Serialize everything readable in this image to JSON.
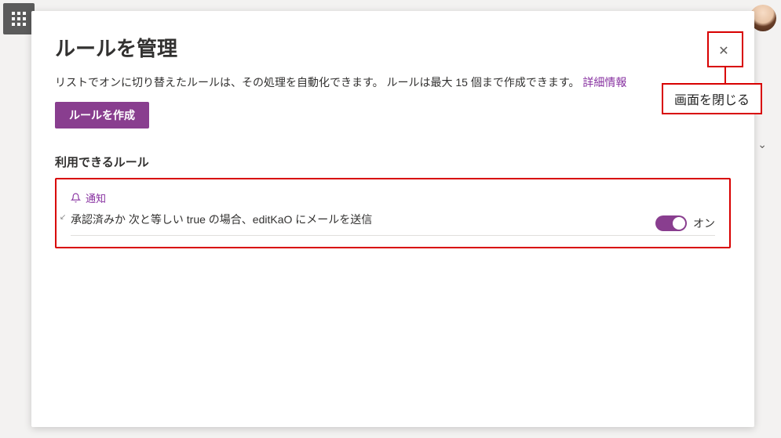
{
  "header": {
    "waffle_name": "app-launcher-icon"
  },
  "panel": {
    "title": "ルールを管理",
    "description": "リストでオンに切り替えたルールは、その処理を自動化できます。 ルールは最大 15 個まで作成できます。",
    "detail_link": "詳細情報",
    "create_button": "ルールを作成",
    "section_header": "利用できるルール",
    "close_label": "✕"
  },
  "annotation": {
    "close_caption": "画面を閉じる"
  },
  "rule": {
    "type_label": "通知",
    "description": "承認済みか 次と等しい true の場合、editKaO にメールを送信",
    "toggle_label": "オン",
    "toggle_state": true
  }
}
